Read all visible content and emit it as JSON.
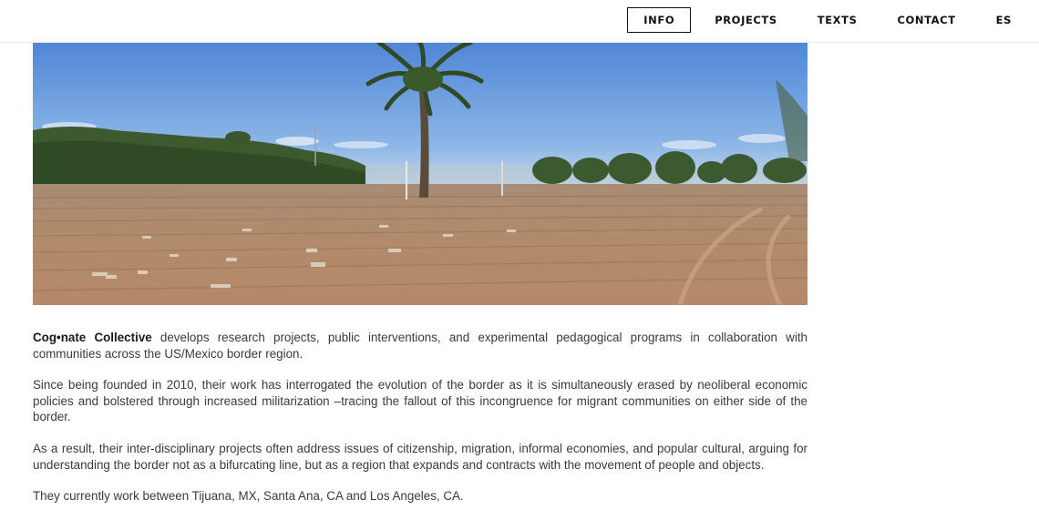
{
  "nav": {
    "items": [
      {
        "label": "INFO",
        "active": true
      },
      {
        "label": "PROJECTS",
        "active": false
      },
      {
        "label": "TEXTS",
        "active": false
      },
      {
        "label": "CONTACT",
        "active": false
      },
      {
        "label": "ES",
        "active": false
      }
    ]
  },
  "hero": {
    "image": "photo of a palm tree in a freshly planted dirt field under a blue sky",
    "colors": {
      "sky": "#6a9ee0",
      "field": "#b08a68",
      "foliage": "#3d5a30"
    }
  },
  "intro": {
    "name": "Cog•nate Collective",
    "p1_rest": " develops research projects, public interventions, and experimental pedagogical programs in collaboration with communities across the US/Mexico border region.",
    "p2": "Since being founded in 2010, their work has interrogated the evolution of the border as it is simultaneously erased by neoliberal economic policies and bolstered through increased militarization –tracing the fallout of this incongruence for migrant communities on either side of the border.",
    "p3": "As a result, their inter-disciplinary projects often address issues of citizenship, migration, informal economies, and popular cultural, arguing for understanding the border not as a bifurcating line, but as a region that expands and contracts with the movement of people and objects.",
    "p4": "They currently work between Tijuana, MX, Santa Ana, CA and Los Angeles, CA."
  }
}
